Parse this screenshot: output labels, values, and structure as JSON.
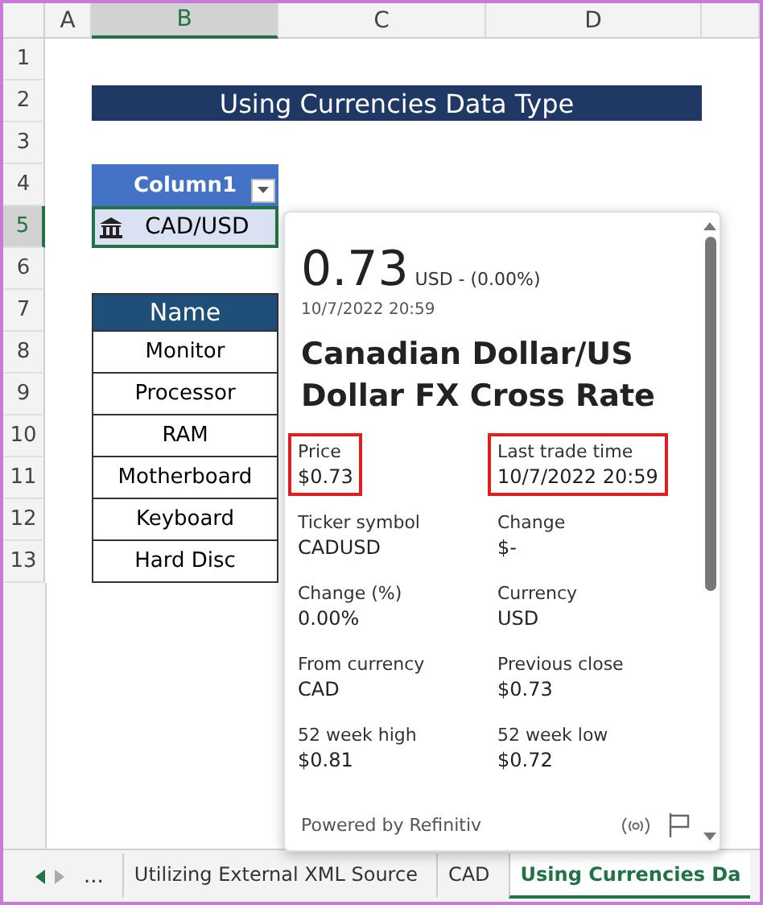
{
  "columns": [
    {
      "label": "A",
      "selected": false
    },
    {
      "label": "B",
      "selected": true
    },
    {
      "label": "C",
      "selected": false
    },
    {
      "label": "D",
      "selected": false
    }
  ],
  "rows": [
    {
      "label": "1",
      "selected": false
    },
    {
      "label": "2",
      "selected": false
    },
    {
      "label": "3",
      "selected": false
    },
    {
      "label": "4",
      "selected": false
    },
    {
      "label": "5",
      "selected": true
    },
    {
      "label": "6",
      "selected": false
    },
    {
      "label": "7",
      "selected": false
    },
    {
      "label": "8",
      "selected": false
    },
    {
      "label": "9",
      "selected": false
    },
    {
      "label": "10",
      "selected": false
    },
    {
      "label": "11",
      "selected": false
    },
    {
      "label": "12",
      "selected": false
    },
    {
      "label": "13",
      "selected": false
    }
  ],
  "title": "Using Currencies Data Type",
  "currency_table": {
    "header": "Column1",
    "cell": "CAD/USD",
    "selected": true
  },
  "name_table": {
    "header": "Name",
    "items": [
      "Monitor",
      "Processor",
      "RAM",
      "Motherboard",
      "Keyboard",
      "Hard Disc"
    ]
  },
  "card": {
    "price": "0.73",
    "price_suffix": "USD - (0.00%)",
    "timestamp": "10/7/2022 20:59",
    "title": "Canadian Dollar/US Dollar FX Cross Rate",
    "fields": [
      {
        "label": "Price",
        "value": "$0.73",
        "highlighted": true
      },
      {
        "label": "Last trade time",
        "value": "10/7/2022 20:59",
        "highlighted": true
      },
      {
        "label": "Ticker symbol",
        "value": "CADUSD",
        "highlighted": false
      },
      {
        "label": "Change",
        "value": "$-",
        "highlighted": false
      },
      {
        "label": "Change (%)",
        "value": "0.00%",
        "highlighted": false
      },
      {
        "label": "Currency",
        "value": "USD",
        "highlighted": false
      },
      {
        "label": "From currency",
        "value": "CAD",
        "highlighted": false
      },
      {
        "label": "Previous close",
        "value": "$0.73",
        "highlighted": false
      },
      {
        "label": "52 week high",
        "value": "$0.81",
        "highlighted": false
      },
      {
        "label": "52 week low",
        "value": "$0.72",
        "highlighted": false
      }
    ],
    "footer": "Powered by Refinitiv"
  },
  "sheet_tabs": {
    "more": "...",
    "tabs": [
      {
        "label": "Utilizing External XML Source",
        "selected": false
      },
      {
        "label": "CAD",
        "selected": false
      },
      {
        "label": "Using Currencies Da",
        "selected": true
      }
    ]
  }
}
